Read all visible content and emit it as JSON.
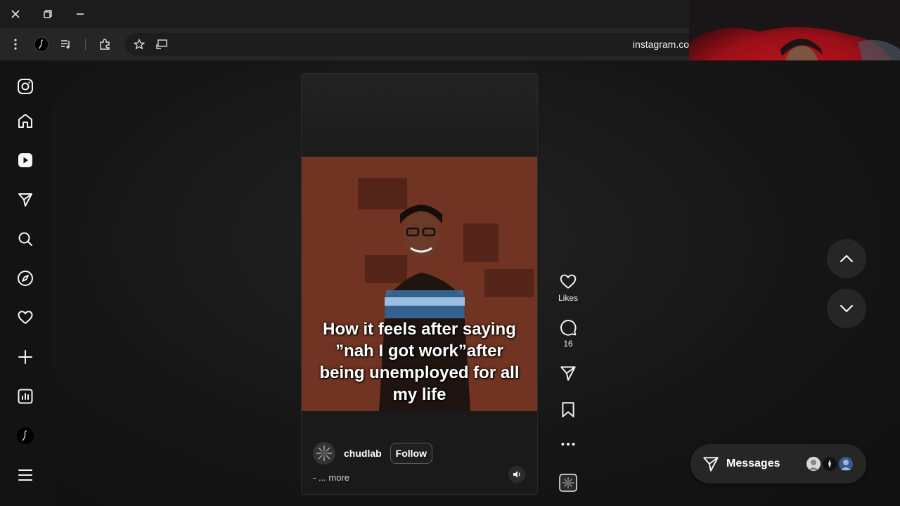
{
  "browser": {
    "url": "instagram.co"
  },
  "sidebar": {
    "items": [
      {
        "name": "instagram-logo-icon"
      },
      {
        "name": "home-icon"
      },
      {
        "name": "reels-icon"
      },
      {
        "name": "direct-send-icon"
      },
      {
        "name": "search-icon"
      },
      {
        "name": "explore-compass-icon"
      },
      {
        "name": "notifications-heart-icon"
      },
      {
        "name": "create-plus-icon"
      },
      {
        "name": "dashboard-icon"
      },
      {
        "name": "threads-icon"
      },
      {
        "name": "menu-icon"
      }
    ]
  },
  "reel": {
    "caption_lines": [
      "How it feels after saying",
      "”nah I got work”after",
      "being unemployed for all",
      "my life"
    ],
    "username": "chudlab",
    "follow_label": "Follow",
    "description": "- ... more"
  },
  "actions": {
    "likes_label": "Likes",
    "comments_count": "16"
  },
  "messages": {
    "label": "Messages"
  },
  "colors": {
    "background": "#131313",
    "panel": "#262626",
    "video_tint": "#8a4230"
  }
}
